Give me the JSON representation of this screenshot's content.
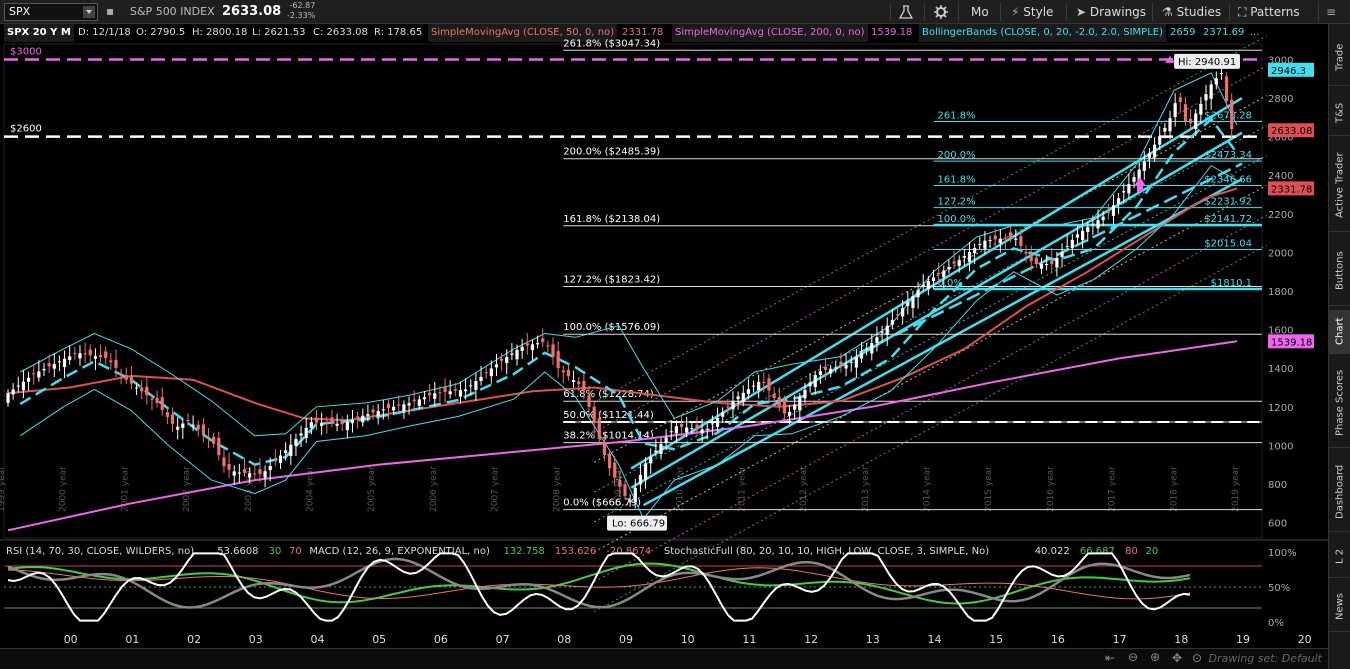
{
  "toolbar": {
    "symbol": "SPX",
    "symbol_name": "S&P 500 INDEX",
    "last": "2633.08",
    "change": "-62.87",
    "change_pct": "-2.33%",
    "beaker_icon": "beaker-icon",
    "gear_icon": "gear-icon",
    "aggregation": "Mo",
    "style_label": "Style",
    "drawings_label": "Drawings",
    "studies_label": "Studies",
    "patterns_label": "Patterns"
  },
  "info": {
    "series": "SPX 20 Y M",
    "date": "D: 12/1/18",
    "open": "O: 2790.5",
    "high": "H: 2800.18",
    "low": "L: 2621.53",
    "close": "C: 2633.08",
    "range": "R: 178.65",
    "sma50_label": "SimpleMovingAvg (CLOSE, 50, 0, no)",
    "sma50_value": "2331.78",
    "sma200_label": "SimpleMovingAvg (CLOSE, 200, 0, no)",
    "sma200_value": "1539.18",
    "bb_label": "BollingerBands (CLOSE, 0, 20, -2.0, 2.0, SIMPLE)",
    "bb_upper": "2659",
    "bb_lower": "2371.69",
    "more": "..."
  },
  "sidebar": {
    "tabs": [
      "Trade",
      "T&S",
      "Active Trader",
      "Buttons",
      "Chart",
      "Phase Scores",
      "Dashboard",
      "L 2",
      "News"
    ],
    "active": "Chart"
  },
  "colors": {
    "up": "#ffffff",
    "down": "#f07070",
    "cyan": "#40e0f0",
    "sma50": "#e05050",
    "sma200": "#ee66ee",
    "fib": "#ffffff"
  },
  "chart_data": [
    {
      "type": "candlestick",
      "title": "SPX 20 Y M",
      "ylim": [
        520,
        3080
      ],
      "y_ticks": [
        600,
        800,
        1000,
        1200,
        1400,
        1600,
        1800,
        2000,
        2200,
        2400,
        2600,
        2800,
        3000
      ],
      "x_year_labels": [
        "1999 year",
        "2000 year",
        "2001 year",
        "2002 year",
        "2003 year",
        "2004 year",
        "2005 year",
        "2006 year",
        "2007 year",
        "2008 year",
        "2009 year",
        "2010 year",
        "2011 year",
        "2012 year",
        "2013 year",
        "2014 year",
        "2015 year",
        "2016 year",
        "2017 year",
        "2018 year",
        "2019 year"
      ],
      "x_ticks": [
        "00",
        "01",
        "02",
        "03",
        "04",
        "05",
        "06",
        "07",
        "08",
        "09",
        "10",
        "11",
        "12",
        "13",
        "14",
        "15",
        "16",
        "17",
        "18",
        "19",
        "20"
      ],
      "price_path": [
        [
          1999.0,
          1250
        ],
        [
          1999.5,
          1370
        ],
        [
          2000.2,
          1480
        ],
        [
          2000.7,
          1450
        ],
        [
          2001.0,
          1340
        ],
        [
          2001.5,
          1220
        ],
        [
          2001.8,
          1090
        ],
        [
          2002.0,
          1130
        ],
        [
          2002.4,
          1020
        ],
        [
          2002.6,
          880
        ],
        [
          2002.8,
          860
        ],
        [
          2003.2,
          850
        ],
        [
          2003.6,
          980
        ],
        [
          2004.0,
          1120
        ],
        [
          2004.5,
          1110
        ],
        [
          2004.8,
          1150
        ],
        [
          2005.2,
          1190
        ],
        [
          2005.6,
          1220
        ],
        [
          2006.0,
          1270
        ],
        [
          2006.5,
          1290
        ],
        [
          2007.0,
          1420
        ],
        [
          2007.4,
          1510
        ],
        [
          2007.8,
          1540
        ],
        [
          2008.0,
          1400
        ],
        [
          2008.4,
          1300
        ],
        [
          2008.8,
          900
        ],
        [
          2009.15,
          700
        ],
        [
          2009.4,
          900
        ],
        [
          2009.9,
          1100
        ],
        [
          2010.4,
          1080
        ],
        [
          2010.9,
          1250
        ],
        [
          2011.3,
          1340
        ],
        [
          2011.7,
          1150
        ],
        [
          2012.2,
          1380
        ],
        [
          2012.7,
          1420
        ],
        [
          2013.0,
          1500
        ],
        [
          2013.5,
          1680
        ],
        [
          2013.9,
          1830
        ],
        [
          2014.5,
          1960
        ],
        [
          2014.9,
          2060
        ],
        [
          2015.4,
          2080
        ],
        [
          2015.7,
          1940
        ],
        [
          2016.0,
          1940
        ],
        [
          2016.4,
          2090
        ],
        [
          2016.9,
          2200
        ],
        [
          2017.4,
          2420
        ],
        [
          2017.9,
          2680
        ],
        [
          2018.05,
          2820
        ],
        [
          2018.2,
          2640
        ],
        [
          2018.6,
          2880
        ],
        [
          2018.75,
          2930
        ],
        [
          2018.92,
          2633
        ]
      ],
      "sma50": [
        [
          1999.0,
          1270
        ],
        [
          2000.0,
          1300
        ],
        [
          2001.0,
          1360
        ],
        [
          2002.0,
          1340
        ],
        [
          2003.0,
          1220
        ],
        [
          2003.8,
          1140
        ],
        [
          2004.5,
          1130
        ],
        [
          2005.5,
          1180
        ],
        [
          2006.5,
          1230
        ],
        [
          2007.5,
          1280
        ],
        [
          2008.5,
          1300
        ],
        [
          2009.5,
          1260
        ],
        [
          2010.5,
          1220
        ],
        [
          2011.5,
          1200
        ],
        [
          2012.5,
          1230
        ],
        [
          2013.5,
          1350
        ],
        [
          2014.5,
          1500
        ],
        [
          2015.5,
          1720
        ],
        [
          2016.5,
          1900
        ],
        [
          2017.5,
          2100
        ],
        [
          2018.4,
          2280
        ],
        [
          2018.92,
          2331.78
        ]
      ],
      "sma200": [
        [
          1999.0,
          560
        ],
        [
          2001.0,
          700
        ],
        [
          2003.0,
          820
        ],
        [
          2005.0,
          900
        ],
        [
          2007.0,
          960
        ],
        [
          2009.0,
          1020
        ],
        [
          2011.0,
          1100
        ],
        [
          2013.0,
          1200
        ],
        [
          2015.0,
          1330
        ],
        [
          2017.0,
          1450
        ],
        [
          2018.92,
          1539.18
        ]
      ],
      "bb_upper_path": [
        [
          1999.2,
          1380
        ],
        [
          1999.9,
          1500
        ],
        [
          2000.4,
          1580
        ],
        [
          2001.0,
          1500
        ],
        [
          2001.6,
          1380
        ],
        [
          2002.3,
          1230
        ],
        [
          2003.0,
          1050
        ],
        [
          2003.5,
          1060
        ],
        [
          2004.0,
          1200
        ],
        [
          2004.8,
          1220
        ],
        [
          2005.5,
          1260
        ],
        [
          2006.3,
          1320
        ],
        [
          2007.2,
          1500
        ],
        [
          2007.7,
          1580
        ],
        [
          2008.2,
          1560
        ],
        [
          2008.9,
          1620
        ],
        [
          2009.3,
          1400
        ],
        [
          2009.8,
          1140
        ],
        [
          2010.5,
          1230
        ],
        [
          2011.1,
          1380
        ],
        [
          2011.7,
          1420
        ],
        [
          2012.5,
          1460
        ],
        [
          2013.3,
          1620
        ],
        [
          2014.0,
          1900
        ],
        [
          2014.7,
          2080
        ],
        [
          2015.3,
          2140
        ],
        [
          2016.0,
          2140
        ],
        [
          2016.6,
          2180
        ],
        [
          2017.3,
          2460
        ],
        [
          2017.9,
          2840
        ],
        [
          2018.5,
          2930
        ],
        [
          2018.92,
          2659
        ]
      ],
      "bb_lower_path": [
        [
          1999.2,
          1050
        ],
        [
          1999.9,
          1200
        ],
        [
          2000.4,
          1290
        ],
        [
          2001.0,
          1180
        ],
        [
          2001.6,
          1000
        ],
        [
          2002.3,
          820
        ],
        [
          2003.0,
          750
        ],
        [
          2003.5,
          820
        ],
        [
          2004.0,
          1020
        ],
        [
          2004.8,
          1050
        ],
        [
          2005.5,
          1100
        ],
        [
          2006.3,
          1150
        ],
        [
          2007.2,
          1240
        ],
        [
          2007.7,
          1380
        ],
        [
          2008.2,
          1250
        ],
        [
          2008.9,
          900
        ],
        [
          2009.3,
          620
        ],
        [
          2009.8,
          820
        ],
        [
          2010.5,
          900
        ],
        [
          2011.1,
          1050
        ],
        [
          2011.7,
          1060
        ],
        [
          2012.5,
          1150
        ],
        [
          2013.3,
          1280
        ],
        [
          2014.0,
          1500
        ],
        [
          2014.7,
          1750
        ],
        [
          2015.3,
          1900
        ],
        [
          2016.0,
          1780
        ],
        [
          2016.6,
          1860
        ],
        [
          2017.3,
          2020
        ],
        [
          2017.9,
          2200
        ],
        [
          2018.5,
          2450
        ],
        [
          2018.92,
          2371.69
        ]
      ],
      "fib_left": [
        {
          "label": "261.8%  ($3047.34)",
          "y": 3047.34
        },
        {
          "label": "200.0%  ($2485.39)",
          "y": 2485.39
        },
        {
          "label": "161.8%  ($2138.04)",
          "y": 2138.04
        },
        {
          "label": "127.2%  ($1823.42)",
          "y": 1823.42
        },
        {
          "label": "100.0%  ($1576.09)",
          "y": 1576.09
        },
        {
          "label": "61.8%  ($1228.74)",
          "y": 1228.74
        },
        {
          "label": "50.0%  ($1121.44)",
          "y": 1121.44
        },
        {
          "label": "38.2%  ($1014.14)",
          "y": 1014.14
        },
        {
          "label": "0.0%  ($666.79)",
          "y": 666.79
        }
      ],
      "fib_right": [
        {
          "label": "261.8%",
          "price": "$2678.28",
          "y": 2678.28
        },
        {
          "label": "200.0%",
          "price": "$2473.34",
          "y": 2473.34
        },
        {
          "label": "161.8%",
          "price": "$2346.66",
          "y": 2346.66
        },
        {
          "label": "127.2%",
          "price": "$2231.92",
          "y": 2231.92
        },
        {
          "label": "100.0%",
          "price": "$2141.72",
          "y": 2141.72
        },
        {
          "label": "",
          "price": "$2015.04",
          "y": 2015.04
        },
        {
          "label": "0.0%",
          "price": "$1810.1",
          "y": 1810.1
        }
      ],
      "price_lines": [
        {
          "label": "$3000",
          "y": 3000,
          "color": "#ee66ee"
        },
        {
          "label": "$2600",
          "y": 2600,
          "color": "#ffffff"
        }
      ],
      "price_tags": [
        {
          "label": "2946.3",
          "y": 2946.3,
          "color": "#40e0f0"
        },
        {
          "label": "2633.08",
          "y": 2633.08,
          "color": "#e05050"
        },
        {
          "label": "2331.78",
          "y": 2331.78,
          "color": "#e05050"
        },
        {
          "label": "1539.18",
          "y": 1539.18,
          "color": "#ee66ee"
        }
      ],
      "hi_label": "Hi: 2940.91",
      "lo_label": "Lo: 666.79"
    },
    {
      "type": "line",
      "title": "RSI / MACD / StochasticFull",
      "indicators": [
        {
          "label": "RSI (14, 70, 30, CLOSE, WILDERS, no)",
          "values": [
            "53.6608",
            "30",
            "70"
          ]
        },
        {
          "label": "MACD (12, 26, 9, EXPONENTIAL, no)",
          "values": [
            "132.758",
            "153.626",
            "-20.8674"
          ]
        },
        {
          "label": "StochasticFull (80, 20, 10, 10, HIGH, LOW, CLOSE, 3, SIMPLE, No)",
          "values": [
            "40.022",
            "66.687",
            "80",
            "20"
          ]
        }
      ],
      "y_ticks": [
        "100%",
        "50%",
        "0%"
      ]
    }
  ],
  "footer": {
    "drawing_set": "Drawing set: Default"
  }
}
